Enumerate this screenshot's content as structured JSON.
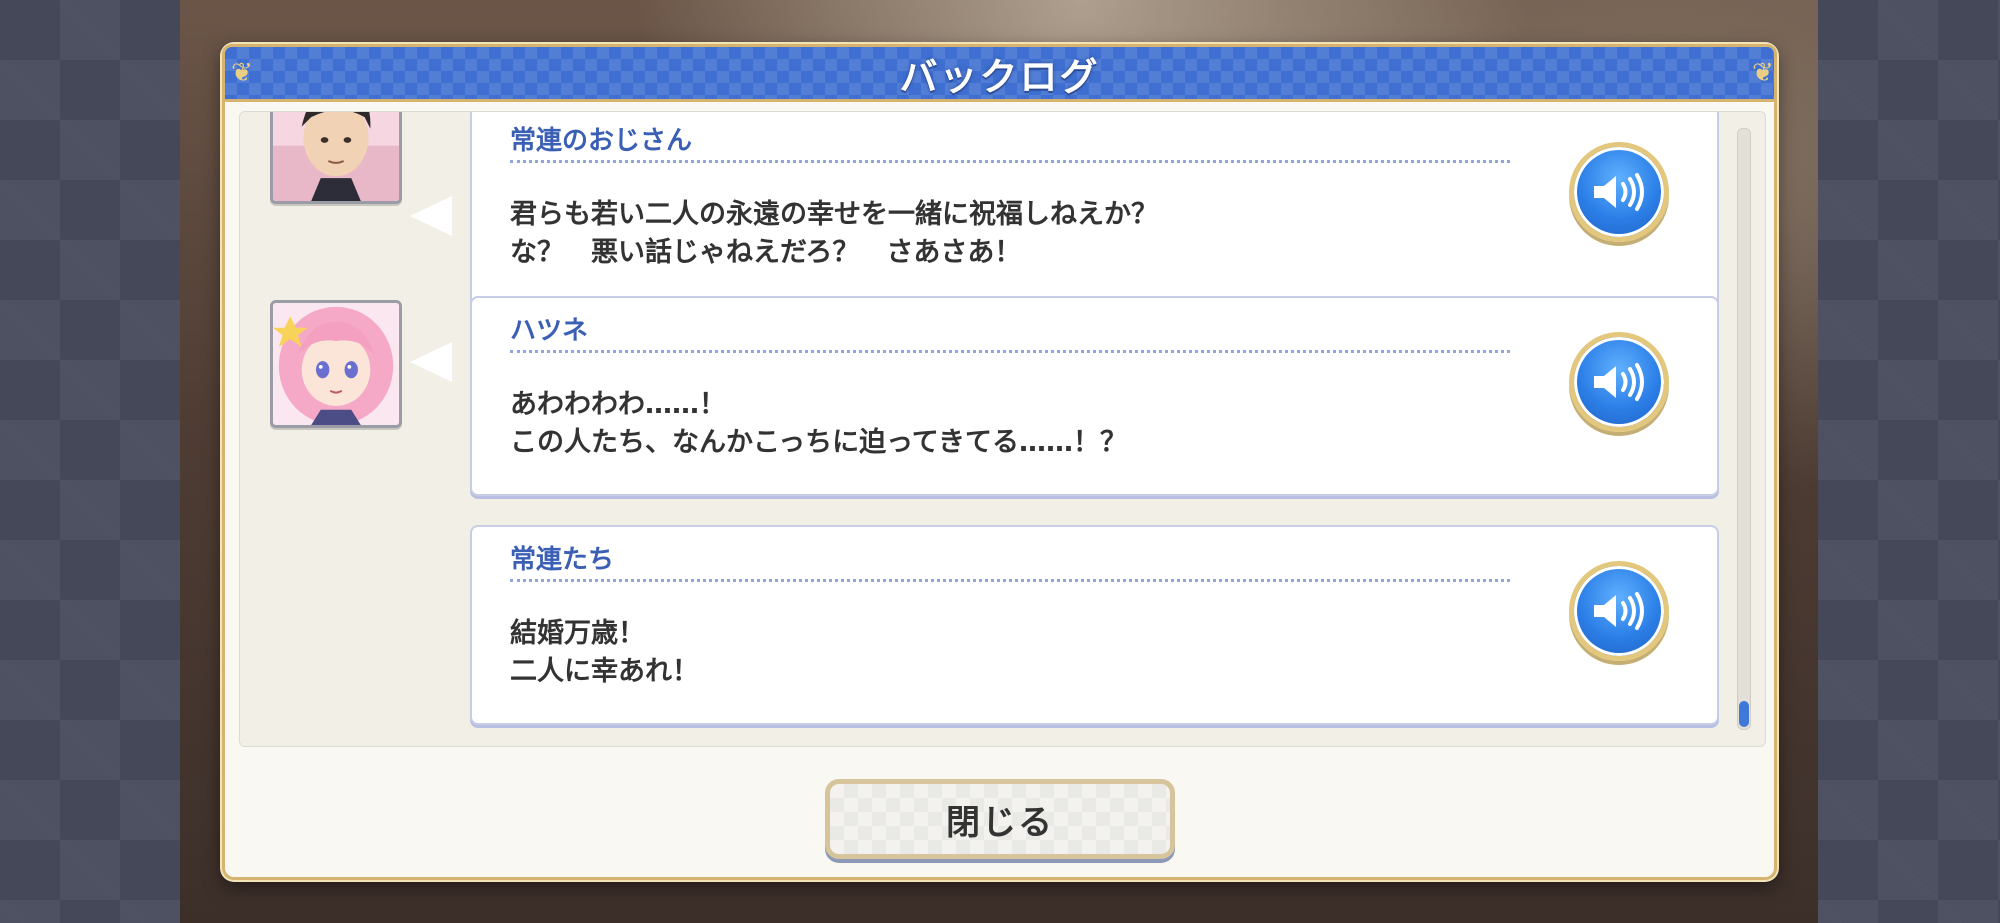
{
  "dialog": {
    "title": "バックログ",
    "close_label": "閉じる"
  },
  "entries": [
    {
      "speaker": "常連のおじさん",
      "lines": [
        "君らも若い二人の永遠の幸せを一緒に祝福しねえか？",
        "な？　悪い話じゃねえだろ？　さあさあ！"
      ],
      "has_avatar": true
    },
    {
      "speaker": "ハツネ",
      "lines": [
        "あわわわわ……！",
        "この人たち、なんかこっちに迫ってきてる……！？"
      ],
      "has_avatar": true
    },
    {
      "speaker": "常連たち",
      "lines": [
        "結婚万歳！",
        "二人に幸あれ！"
      ],
      "has_avatar": false
    }
  ],
  "icons": {
    "voice": "speaker-volume-icon",
    "corner": "ornament-icon"
  },
  "colors": {
    "title_bar": "#3e6fd1",
    "speaker_name": "#3b5fb4",
    "gold_border": "#d6b470",
    "voice_button": "#2b7ee6"
  },
  "scroll": {
    "position": 1.0
  }
}
